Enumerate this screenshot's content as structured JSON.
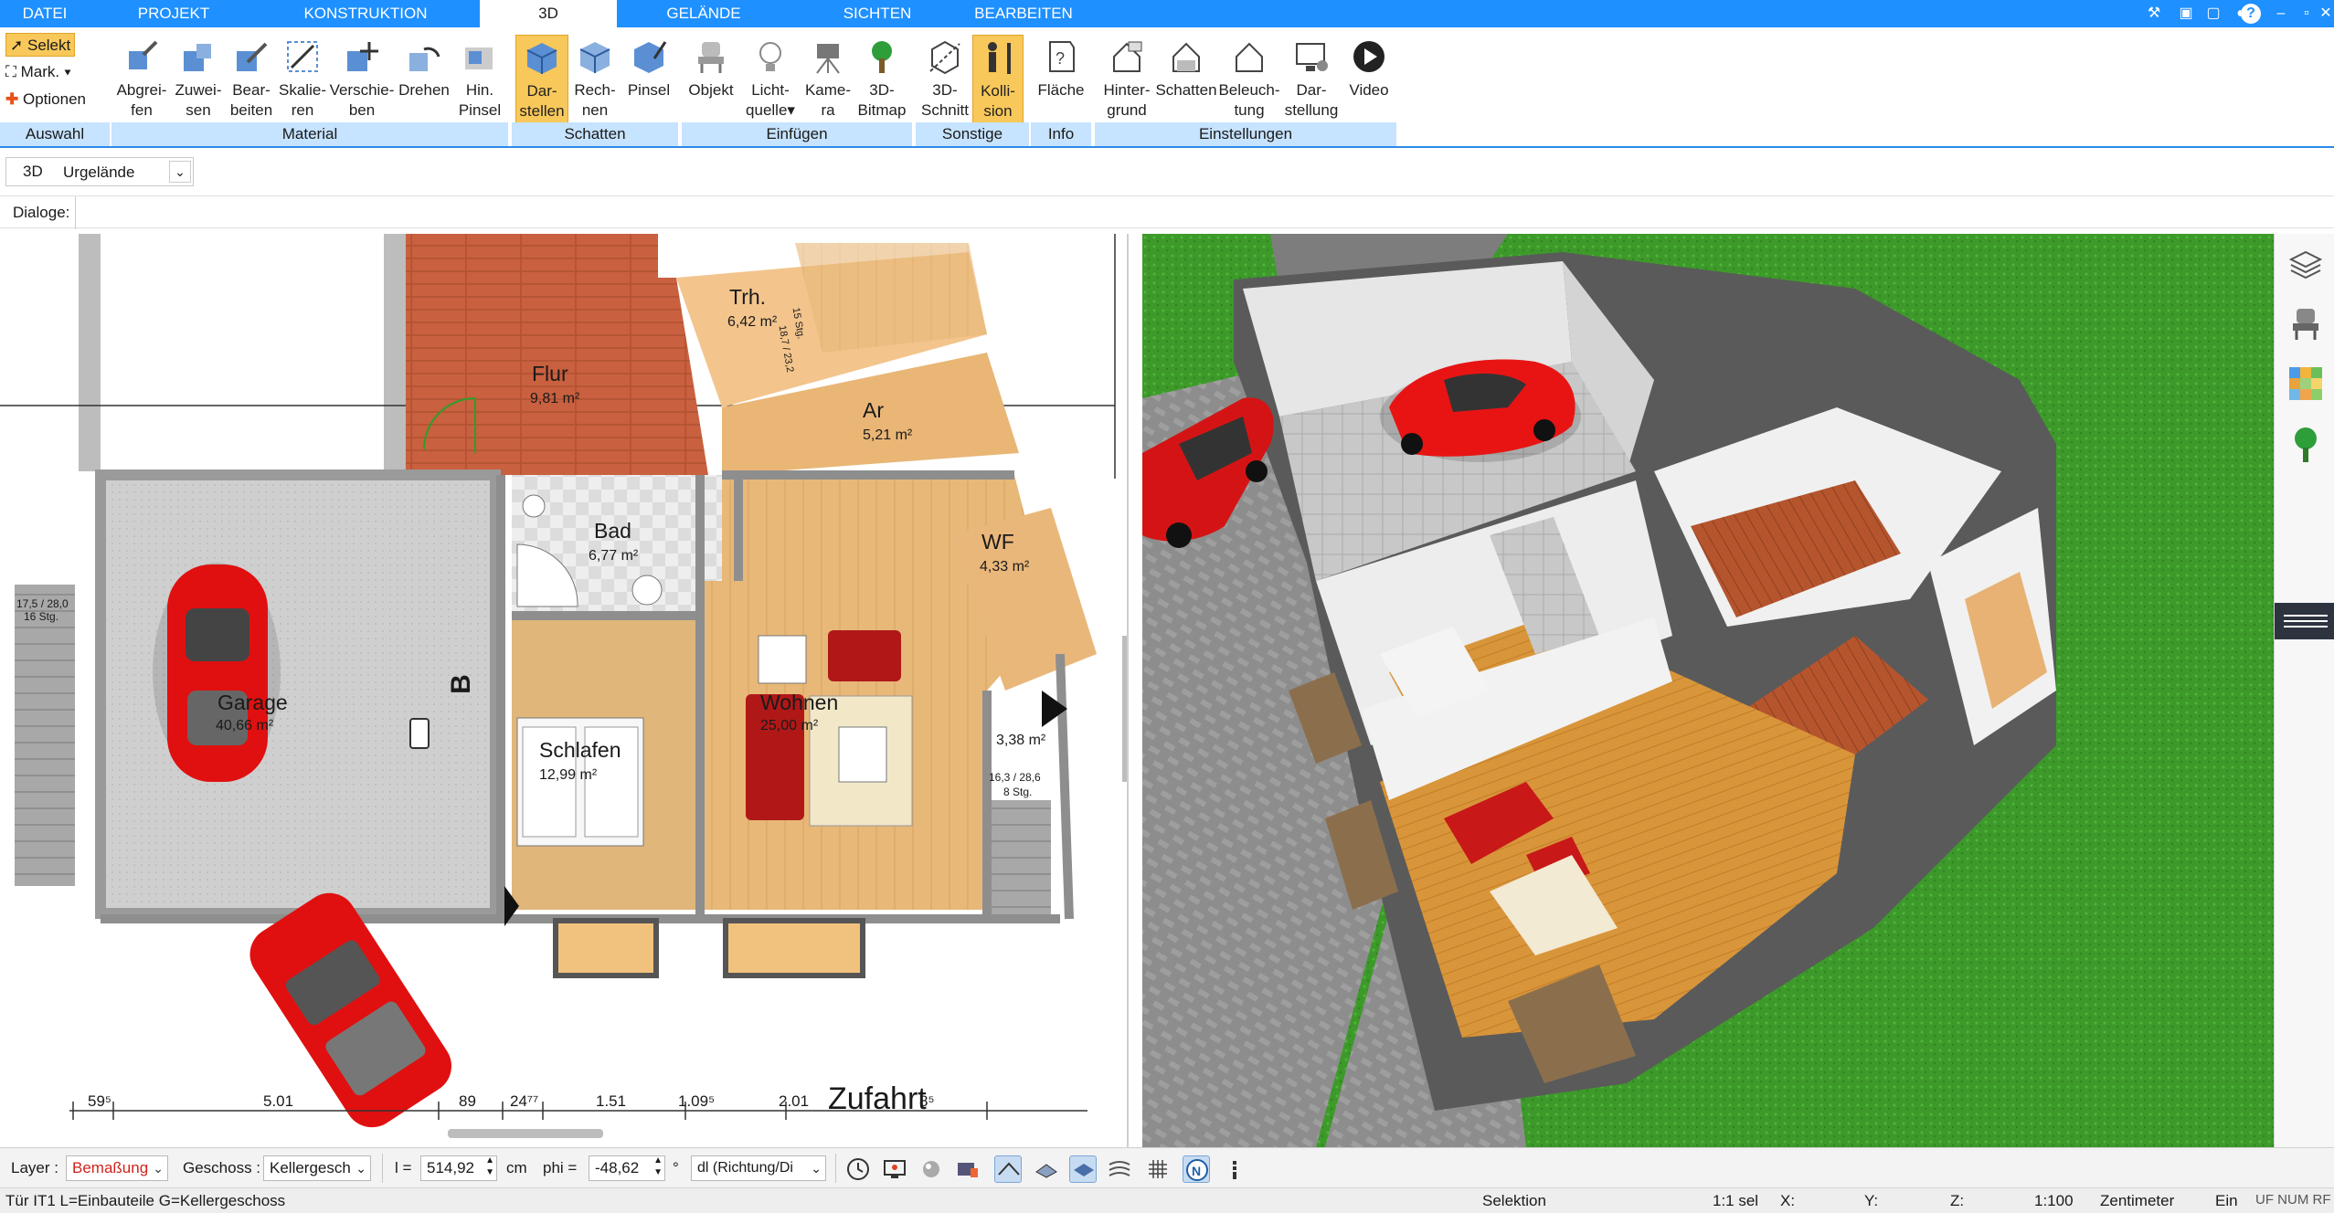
{
  "tabs": [
    "DATEI",
    "PROJEKT",
    "KONSTRUKTION",
    "3D",
    "GELÄNDE",
    "SICHTEN",
    "BEARBEITEN"
  ],
  "window_icons": {
    "help": "?"
  },
  "ribbon": {
    "auswahl": {
      "select": "Selekt",
      "mark": "Mark.",
      "options": "Optionen",
      "group": "Auswahl"
    },
    "material": {
      "buttons": [
        {
          "line1": "Abgrei-",
          "line2": "fen"
        },
        {
          "line1": "Zuwei-",
          "line2": "sen"
        },
        {
          "line1": "Bear-",
          "line2": "beiten"
        },
        {
          "line1": "Skalie-",
          "line2": "ren"
        },
        {
          "line1": "Verschie-",
          "line2": "ben"
        },
        {
          "line1": "Drehen",
          "line2": ""
        },
        {
          "line1": "Hin.",
          "line2": "Pinsel"
        }
      ],
      "group": "Material"
    },
    "schatten": {
      "buttons": [
        {
          "line1": "Dar-",
          "line2": "stellen"
        },
        {
          "line1": "Rech-",
          "line2": "nen"
        },
        {
          "line1": "Pinsel",
          "line2": ""
        }
      ],
      "group": "Schatten"
    },
    "einfuegen": {
      "buttons": [
        {
          "line1": "Objekt",
          "line2": ""
        },
        {
          "line1": "Licht-",
          "line2": "quelle"
        },
        {
          "line1": "Kame-",
          "line2": "ra"
        },
        {
          "line1": "3D-",
          "line2": "Bitmap"
        }
      ],
      "group": "Einfügen"
    },
    "sonstige": {
      "buttons": [
        {
          "line1": "3D-",
          "line2": "Schnitt"
        },
        {
          "line1": "Kolli-",
          "line2": "sion"
        }
      ],
      "group": "Sonstige"
    },
    "info": {
      "buttons": [
        {
          "line1": "Fläche",
          "line2": ""
        }
      ],
      "group": "Info"
    },
    "einstellungen": {
      "buttons": [
        {
          "line1": "Hinter-",
          "line2": "grund"
        },
        {
          "line1": "Schatten",
          "line2": ""
        },
        {
          "line1": "Beleuch-",
          "line2": "tung"
        },
        {
          "line1": "Dar-",
          "line2": "stellung"
        },
        {
          "line1": "Video",
          "line2": ""
        }
      ],
      "group": "Einstellungen"
    }
  },
  "bar3d": {
    "label": "3D",
    "select_value": "Urgelände"
  },
  "dialoge": {
    "label": "Dialoge:"
  },
  "plan": {
    "rooms": [
      {
        "name": "Flur",
        "area": "9,81 m²"
      },
      {
        "name": "Trh.",
        "area": "6,42 m²"
      },
      {
        "name": "Ar",
        "area": "5,21 m²"
      },
      {
        "name": "Bad",
        "area": "6,77 m²"
      },
      {
        "name": "WF",
        "area": "4,33 m²"
      },
      {
        "name": "Garage",
        "area": "40,66 m²"
      },
      {
        "name": "Wohnen",
        "area": "25,00 m²"
      },
      {
        "name": "Schlafen",
        "area": "12,99 m²"
      },
      {
        "name": "",
        "area": "3,38 m²"
      }
    ],
    "stair_notes": {
      "left": "17,5 / 28,0",
      "left2": "16 Stg.",
      "right": "16,3 / 28,6",
      "right2": "8 Stg.",
      "top": "15 Stg.",
      "top2": "18,7 / 23,2"
    },
    "section_mark": "B",
    "driveway_label": "Zufahrt",
    "dimensions": [
      "59⁵",
      "5.01",
      "89",
      "24⁷⁷",
      "1.51",
      "1.09⁵",
      "2.01",
      "8⁵"
    ]
  },
  "bottom": {
    "layer_label": "Layer :",
    "layer_value": "Bemaßung",
    "geschoss_label": "Geschoss :",
    "geschoss_value": "Kellergesch",
    "l_label": "l =",
    "l_value": "514,92",
    "l_unit": "cm",
    "phi_label": "phi =",
    "phi_value": "-48,62",
    "phi_unit": "°",
    "dl_value": "dl (Richtung/Di"
  },
  "status": {
    "left": "Tür IT1 L=Einbauteile G=Kellergeschoss",
    "mode": "Selektion",
    "sel": "1:1 sel",
    "x": "X:",
    "y": "Y:",
    "z": "Z:",
    "scale": "1:100",
    "unit": "Zentimeter",
    "ein": "Ein",
    "flags": "UF NUM RF"
  },
  "colors": {
    "accent": "#1e90ff",
    "ribbon_group": "#c6e3ff",
    "selected_button": "#f8c85a",
    "car_red": "#e01010",
    "grass": "#3d9a2a"
  }
}
